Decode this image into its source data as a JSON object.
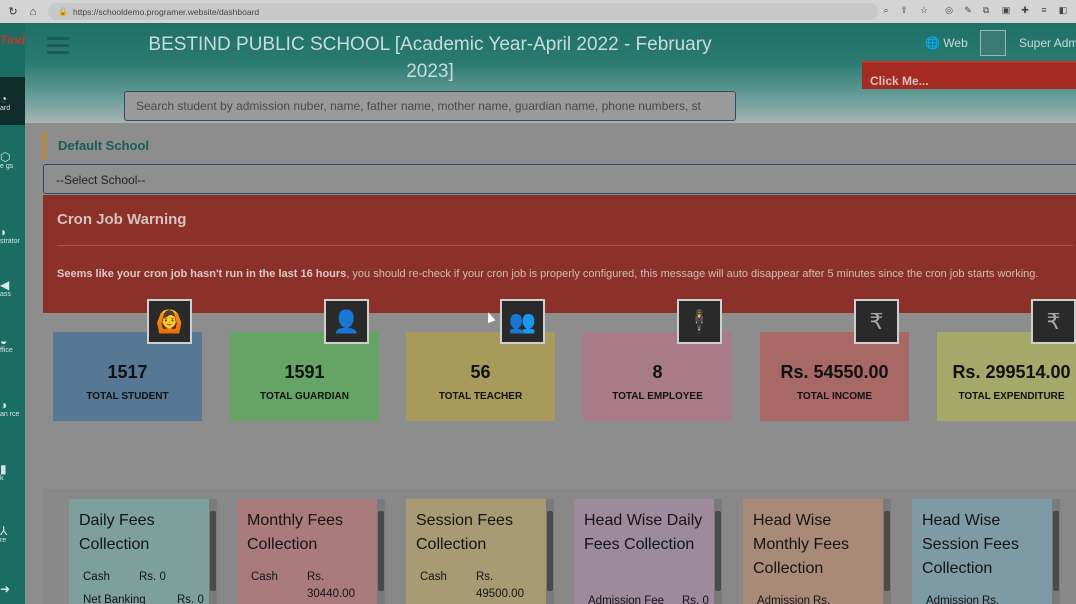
{
  "browser": {
    "url": "https://schooldemo.programer.website/dashboard"
  },
  "sidebar": {
    "logo": "Tind",
    "items": [
      {
        "label": "ard",
        "icon": "dashboard-icon"
      },
      {
        "label": "e gs",
        "icon": "settings-icon"
      },
      {
        "label": "strator",
        "icon": "administrator-icon"
      },
      {
        "label": "ass",
        "icon": "class-icon"
      },
      {
        "label": "ffice",
        "icon": "office-icon"
      },
      {
        "label": "an rce",
        "icon": "human-resource-icon"
      },
      {
        "label": "k",
        "icon": "book-icon"
      },
      {
        "label": "re",
        "icon": "user-icon"
      }
    ]
  },
  "header": {
    "title": "BESTIND PUBLIC SCHOOL [Academic Year-April 2022 - February 2023]",
    "web_label": "Web",
    "user_label": "Super Adm",
    "click_me": "Click Me...",
    "search_placeholder": "Search student by admission nuber, name, father name, mother name, guardian name, phone numbers, st"
  },
  "school": {
    "label": "Default School",
    "select_value": "--Select School--"
  },
  "warning": {
    "title": "Cron Job Warning",
    "bold_text": "Seems like your cron job hasn't run in the last 16 hours",
    "text": ", you should re-check if your cron job is properly configured, this message will auto disappear after 5 minutes since the cron job starts working."
  },
  "stats": [
    {
      "value": "1517",
      "label": "TOTAL STUDENT",
      "color": "#577894",
      "icon": "student-icon",
      "glyph": "🙆"
    },
    {
      "value": "1591",
      "label": "TOTAL GUARDIAN",
      "color": "#66a466",
      "icon": "guardian-icon",
      "glyph": "👤"
    },
    {
      "value": "56",
      "label": "TOTAL TEACHER",
      "color": "#a89a5a",
      "icon": "teacher-icon",
      "glyph": "👥"
    },
    {
      "value": "8",
      "label": "TOTAL EMPLOYEE",
      "color": "#a97b88",
      "icon": "employee-icon",
      "glyph": "🕴"
    },
    {
      "value": "Rs. 54550.00",
      "label": "TOTAL INCOME",
      "color": "#a86866",
      "icon": "rupee-income-icon",
      "glyph": "₹"
    },
    {
      "value": "Rs. 299514.00",
      "label": "TOTAL EXPENDITURE",
      "color": "#a4a868",
      "icon": "rupee-expenditure-icon",
      "glyph": "₹"
    }
  ],
  "fees": [
    {
      "title": "Daily Fees Collection",
      "color": "#7da09c",
      "rows": [
        {
          "name": "Cash",
          "amount": "Rs. 0"
        },
        {
          "name": "Net Banking",
          "amount": "Rs. 0"
        }
      ]
    },
    {
      "title": "Monthly Fees Collection",
      "color": "#a97b7b",
      "rows": [
        {
          "name": "Cash",
          "amount": "Rs. 30440.00"
        }
      ]
    },
    {
      "title": "Session Fees Collection",
      "color": "#a89a72",
      "rows": [
        {
          "name": "Cash",
          "amount": "Rs. 49500.00"
        }
      ]
    },
    {
      "title": "Head Wise Daily Fees Collection",
      "color": "#9d8a9b",
      "rows": [
        {
          "name": "Admission Fee",
          "amount": "Rs. 0"
        }
      ]
    },
    {
      "title": "Head Wise Monthly Fees Collection",
      "color": "#a98a78",
      "rows": [
        {
          "name": "Admission",
          "amount": "Rs."
        }
      ]
    },
    {
      "title": "Head Wise Session Fees Collection",
      "color": "#7e9aa4",
      "rows": [
        {
          "name": "Admission",
          "amount": "Rs."
        }
      ]
    }
  ]
}
